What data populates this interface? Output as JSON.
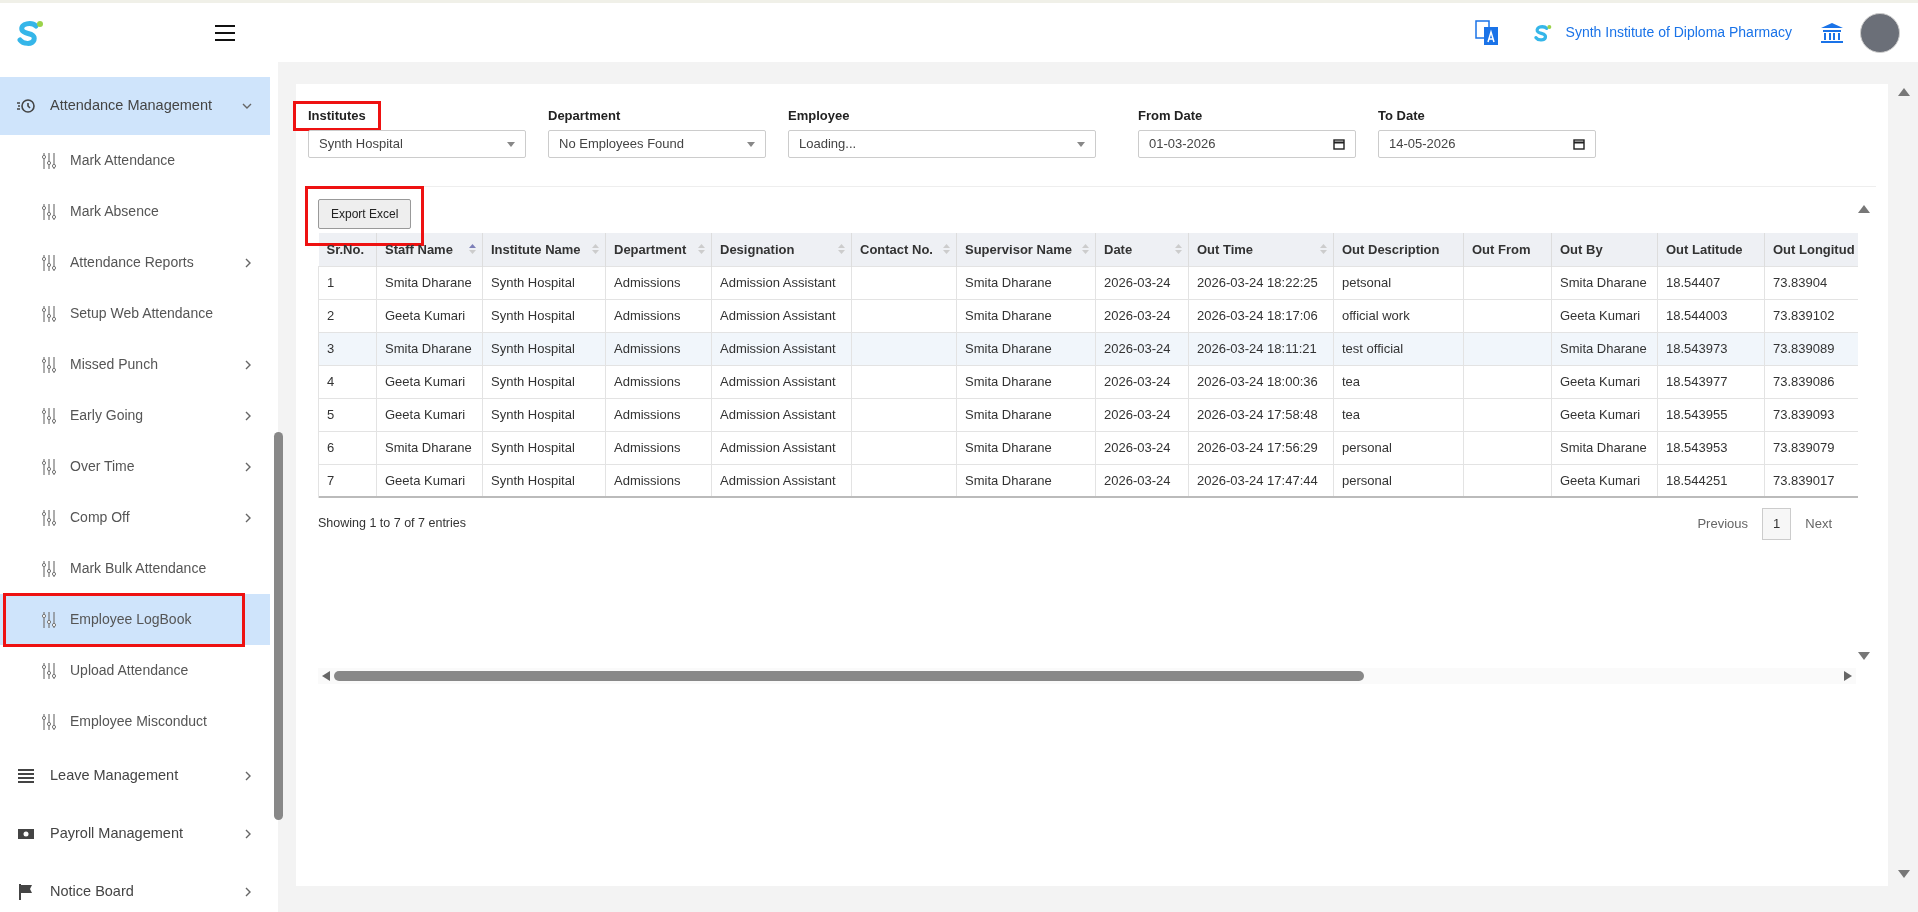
{
  "header": {
    "institute_name": "Synth Institute of Diploma Pharmacy"
  },
  "sidebar": {
    "items": [
      {
        "label": "Attendance Management",
        "expanded": true,
        "selected": true,
        "annotated": false,
        "children": [
          {
            "label": "Mark Attendance",
            "has_submenu": false,
            "selected": false,
            "annotated": false
          },
          {
            "label": "Mark Absence",
            "has_submenu": false,
            "selected": false,
            "annotated": false
          },
          {
            "label": "Attendance Reports",
            "has_submenu": true,
            "selected": false,
            "annotated": false
          },
          {
            "label": "Setup Web Attendance",
            "has_submenu": false,
            "selected": false,
            "annotated": false
          },
          {
            "label": "Missed Punch",
            "has_submenu": true,
            "selected": false,
            "annotated": false
          },
          {
            "label": "Early Going",
            "has_submenu": true,
            "selected": false,
            "annotated": false
          },
          {
            "label": "Over Time",
            "has_submenu": true,
            "selected": false,
            "annotated": false
          },
          {
            "label": "Comp Off",
            "has_submenu": true,
            "selected": false,
            "annotated": false
          },
          {
            "label": "Mark Bulk Attendance",
            "has_submenu": false,
            "selected": false,
            "annotated": false
          },
          {
            "label": "Employee LogBook",
            "has_submenu": false,
            "selected": true,
            "annotated": true
          },
          {
            "label": "Upload Attendance",
            "has_submenu": false,
            "selected": false,
            "annotated": false
          },
          {
            "label": "Employee Misconduct",
            "has_submenu": false,
            "selected": false,
            "annotated": false
          }
        ]
      },
      {
        "label": "Leave Management",
        "expanded": false,
        "selected": false,
        "annotated": false
      },
      {
        "label": "Payroll Management",
        "expanded": false,
        "selected": false,
        "annotated": false
      },
      {
        "label": "Notice Board",
        "expanded": false,
        "selected": false,
        "annotated": false
      }
    ]
  },
  "filters": [
    {
      "label": "Institutes",
      "kind": "select",
      "value": "Synth Hospital",
      "annotated": true
    },
    {
      "label": "Department",
      "kind": "select",
      "value": "No Employees Found",
      "annotated": false
    },
    {
      "label": "Employee",
      "kind": "select",
      "value": "Loading...",
      "annotated": false
    },
    {
      "label": "From Date",
      "kind": "date",
      "value": "01-03-2026",
      "annotated": false
    },
    {
      "label": "To Date",
      "kind": "date",
      "value": "14-05-2026",
      "annotated": false
    }
  ],
  "export_button": {
    "label": "Export Excel",
    "annotated": true
  },
  "table": {
    "columns": [
      {
        "label": "Sr.No.",
        "sortable": false,
        "sorted": false
      },
      {
        "label": "Staff Name",
        "sortable": true,
        "sorted": true
      },
      {
        "label": "Institute Name",
        "sortable": true,
        "sorted": false
      },
      {
        "label": "Department",
        "sortable": true,
        "sorted": false
      },
      {
        "label": "Designation",
        "sortable": true,
        "sorted": false
      },
      {
        "label": "Contact No.",
        "sortable": true,
        "sorted": false
      },
      {
        "label": "Supervisor Name",
        "sortable": true,
        "sorted": false
      },
      {
        "label": "Date",
        "sortable": true,
        "sorted": false
      },
      {
        "label": "Out Time",
        "sortable": true,
        "sorted": false
      },
      {
        "label": "Out Description",
        "sortable": false,
        "sorted": false
      },
      {
        "label": "Out From",
        "sortable": false,
        "sorted": false
      },
      {
        "label": "Out By",
        "sortable": false,
        "sorted": false
      },
      {
        "label": "Out Latitude",
        "sortable": false,
        "sorted": false
      },
      {
        "label": "Out Longitud",
        "sortable": false,
        "sorted": false
      }
    ],
    "rows": [
      {
        "highlighted": false,
        "cells": [
          "1",
          "Smita Dharane",
          "Synth Hospital",
          "Admissions",
          "Admission Assistant",
          "",
          "Smita Dharane",
          "2026-03-24",
          "2026-03-24 18:22:25",
          "petsonal",
          "",
          "Smita Dharane",
          "18.54407",
          "73.83904"
        ]
      },
      {
        "highlighted": false,
        "cells": [
          "2",
          "Geeta Kumari",
          "Synth Hospital",
          "Admissions",
          "Admission Assistant",
          "",
          "Smita Dharane",
          "2026-03-24",
          "2026-03-24 18:17:06",
          "official work",
          "",
          "Geeta Kumari",
          "18.544003",
          "73.839102"
        ]
      },
      {
        "highlighted": true,
        "cells": [
          "3",
          "Smita Dharane",
          "Synth Hospital",
          "Admissions",
          "Admission Assistant",
          "",
          "Smita Dharane",
          "2026-03-24",
          "2026-03-24 18:11:21",
          "test official",
          "",
          "Smita Dharane",
          "18.543973",
          "73.839089"
        ]
      },
      {
        "highlighted": false,
        "cells": [
          "4",
          "Geeta Kumari",
          "Synth Hospital",
          "Admissions",
          "Admission Assistant",
          "",
          "Smita Dharane",
          "2026-03-24",
          "2026-03-24 18:00:36",
          "tea",
          "",
          "Geeta Kumari",
          "18.543977",
          "73.839086"
        ]
      },
      {
        "highlighted": false,
        "cells": [
          "5",
          "Geeta Kumari",
          "Synth Hospital",
          "Admissions",
          "Admission Assistant",
          "",
          "Smita Dharane",
          "2026-03-24",
          "2026-03-24 17:58:48",
          "tea",
          "",
          "Geeta Kumari",
          "18.543955",
          "73.839093"
        ]
      },
      {
        "highlighted": false,
        "cells": [
          "6",
          "Smita Dharane",
          "Synth Hospital",
          "Admissions",
          "Admission Assistant",
          "",
          "Smita Dharane",
          "2026-03-24",
          "2026-03-24 17:56:29",
          "personal",
          "",
          "Smita Dharane",
          "18.543953",
          "73.839079"
        ]
      },
      {
        "highlighted": false,
        "cells": [
          "7",
          "Geeta Kumari",
          "Synth Hospital",
          "Admissions",
          "Admission Assistant",
          "",
          "Smita Dharane",
          "2026-03-24",
          "2026-03-24 17:47:44",
          "personal",
          "",
          "Geeta Kumari",
          "18.544251",
          "73.839017"
        ]
      }
    ]
  },
  "pagination": {
    "info": "Showing 1 to 7 of 7 entries",
    "previous": "Previous",
    "pages": [
      {
        "label": "1",
        "selected": true
      }
    ],
    "next": "Next"
  }
}
